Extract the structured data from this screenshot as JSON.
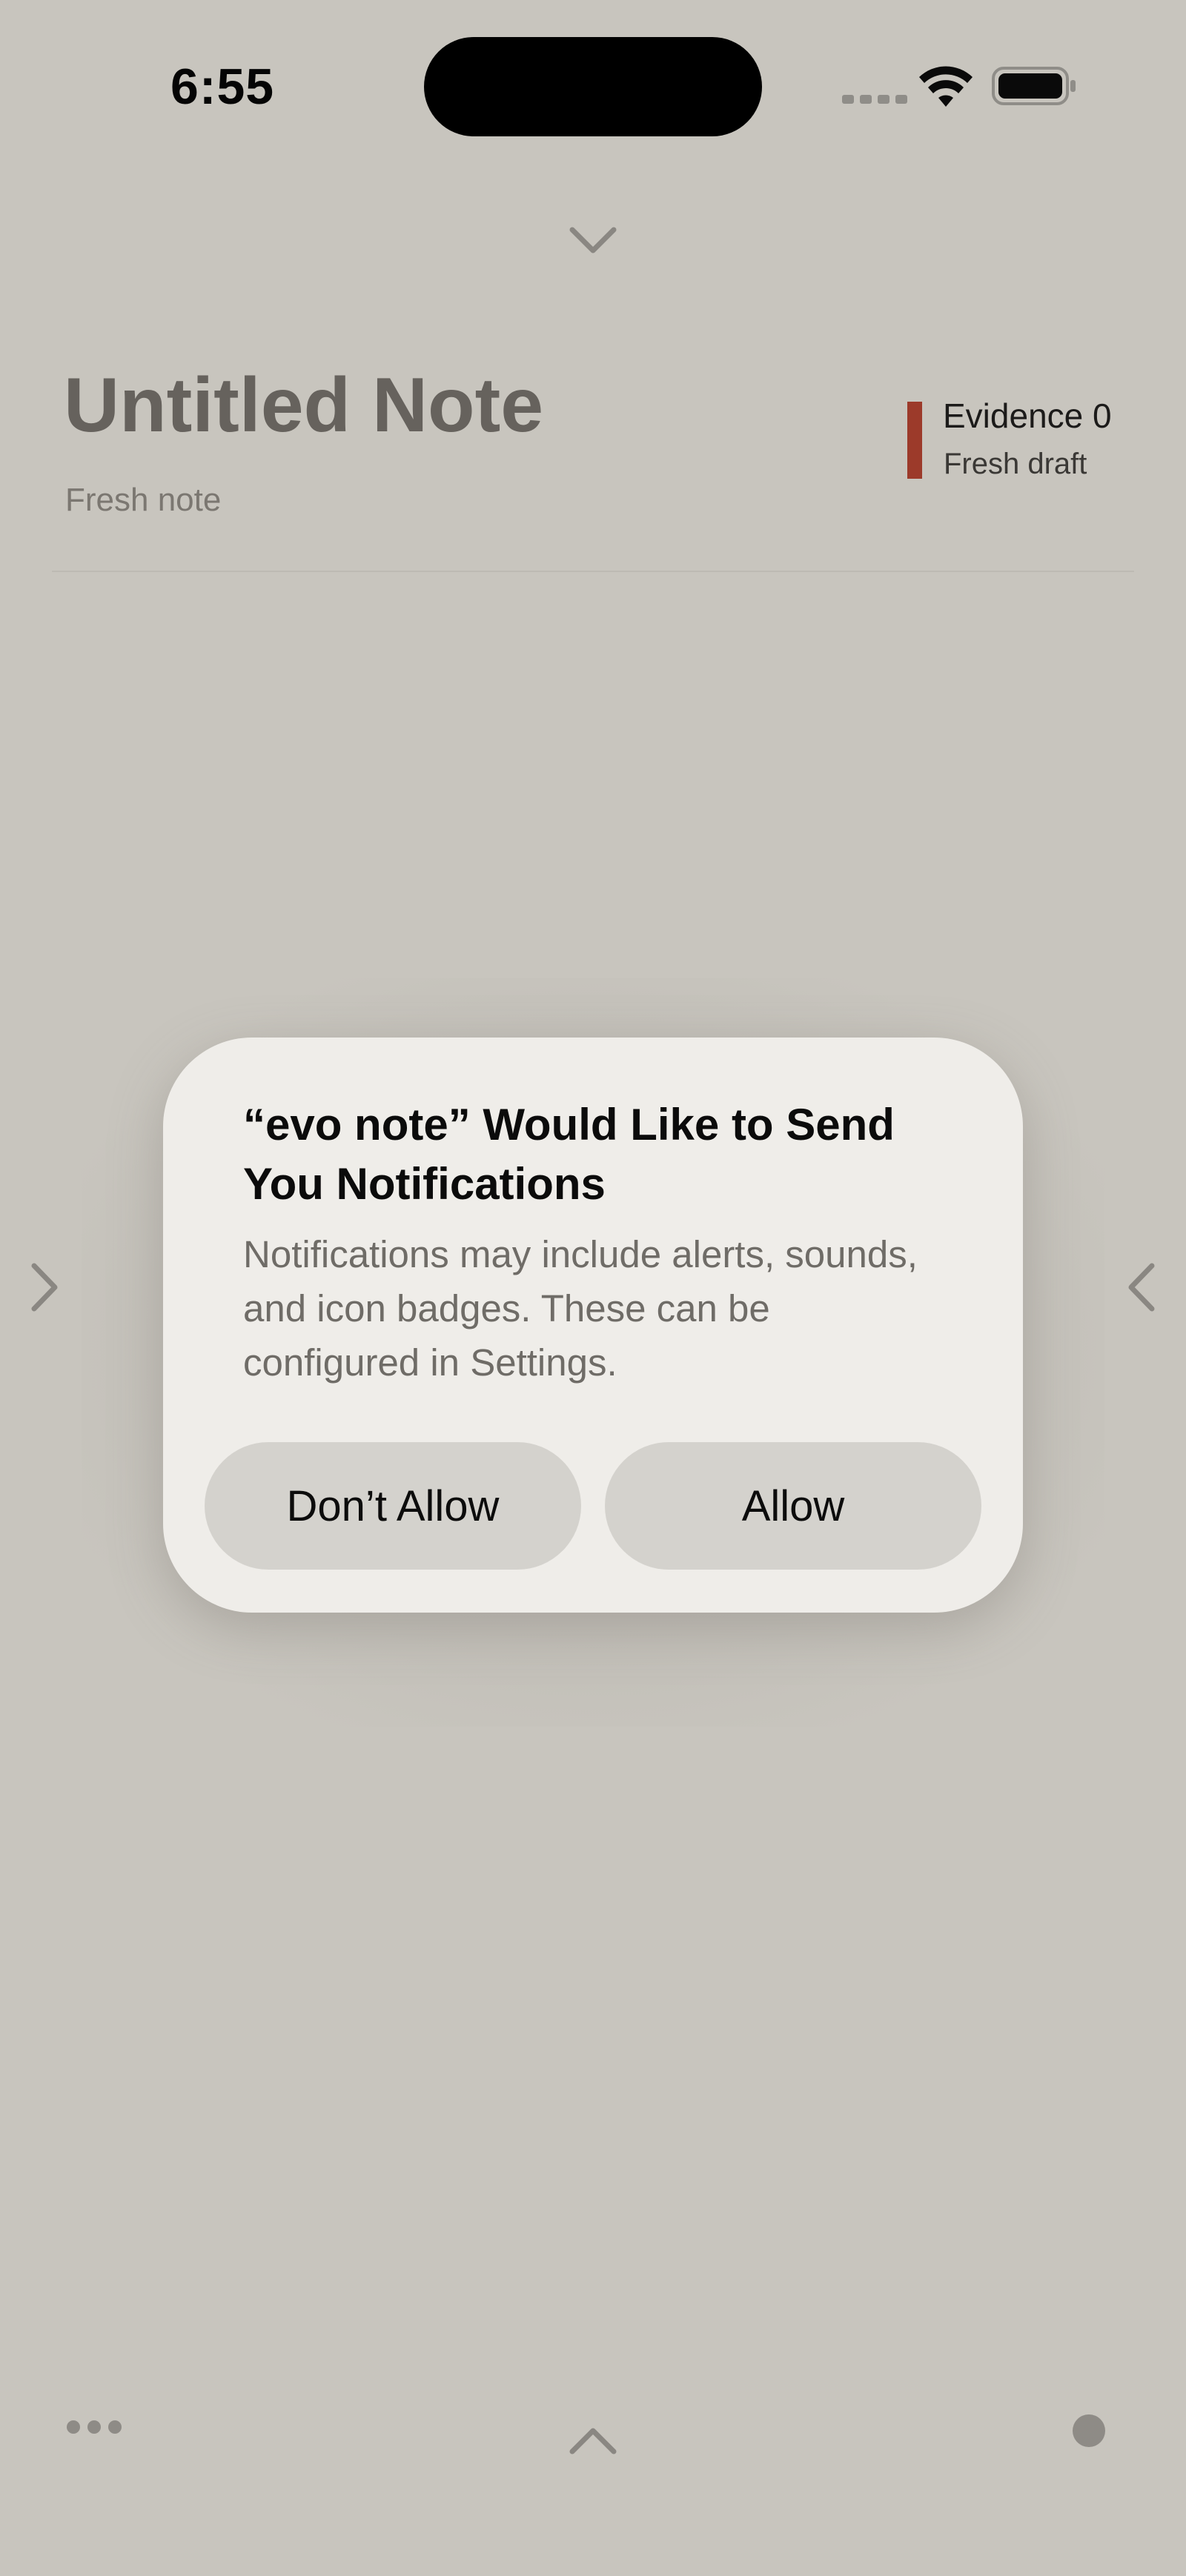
{
  "status_bar": {
    "time": "6:55",
    "icons": [
      "signal-dots-icon",
      "wifi-icon",
      "battery-icon"
    ]
  },
  "note": {
    "title": "Untitled Note",
    "subtitle": "Fresh note",
    "evidence_label": "Evidence 0",
    "evidence_status": "Fresh draft",
    "evidence_accent_color": "#9c3a2a"
  },
  "navigation": {
    "top": "chevron-down-icon",
    "left": "chevron-right-icon",
    "right": "chevron-left-icon",
    "bottom": "chevron-up-icon",
    "bottom_left": "more-icon",
    "bottom_right": "dot-icon"
  },
  "dialog": {
    "title": "“evo note” Would Like to Send You Notifications",
    "message": "Notifications may include alerts, sounds, and icon badges. These can be configured in Settings.",
    "deny_label": "Don’t Allow",
    "allow_label": "Allow"
  },
  "colors": {
    "background": "#c8c5be",
    "dialog_background": "#efede9",
    "button_background": "#d4d2cd"
  }
}
